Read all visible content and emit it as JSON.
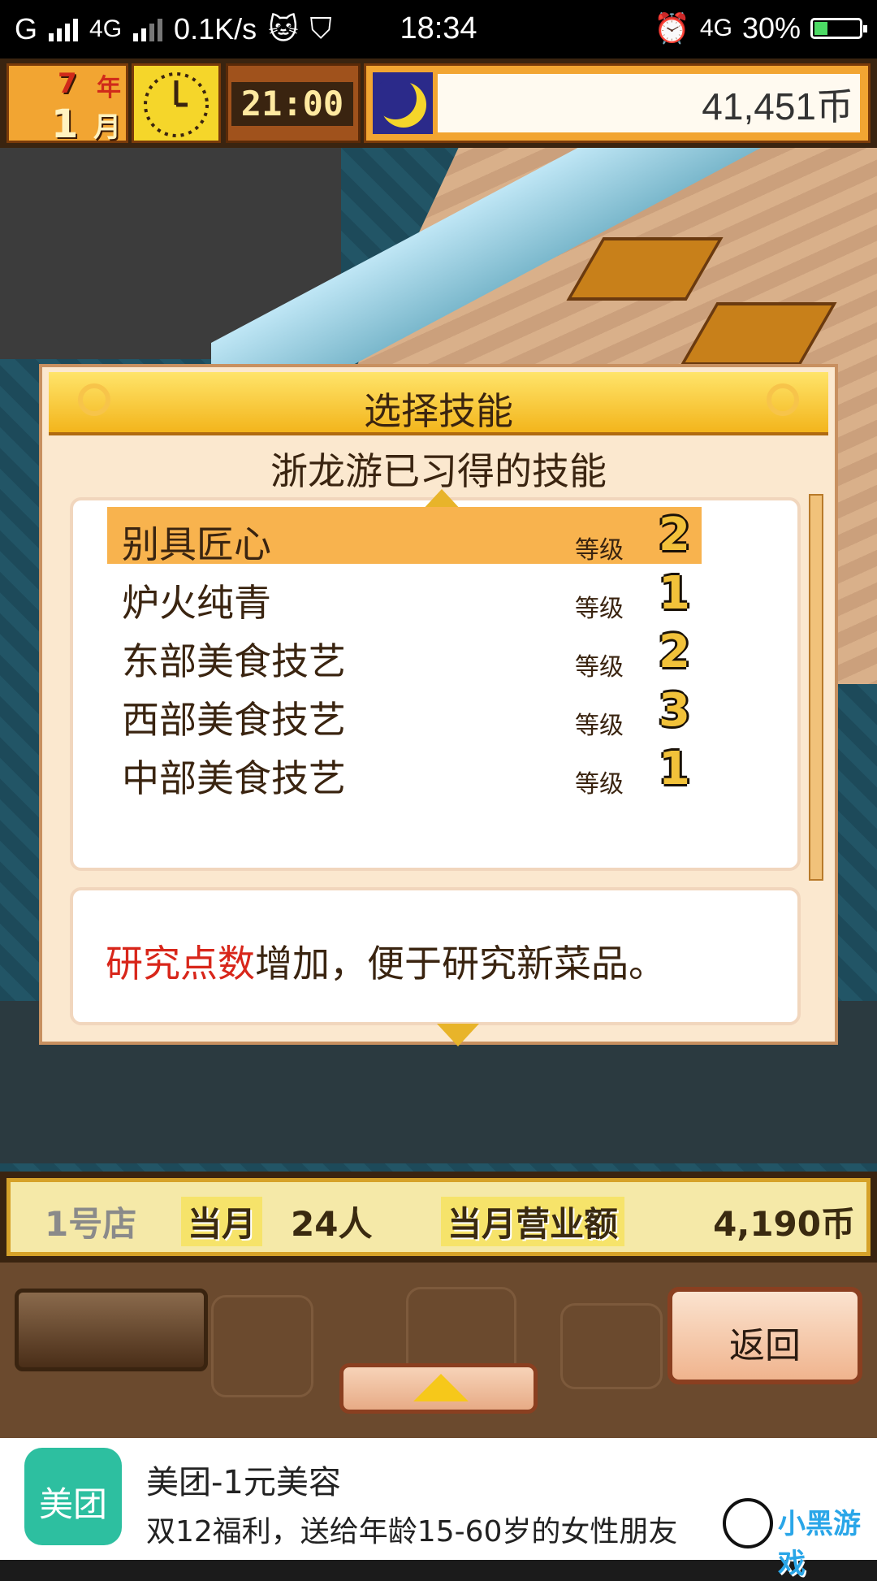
{
  "status_bar": {
    "carrier": "G",
    "network": "4G",
    "speed": "0.1K/s",
    "time": "18:34",
    "network2": "4G",
    "battery": "30%",
    "battery_level": 0.3
  },
  "hud": {
    "year_num": "7",
    "year_label": "年",
    "month_num": "1",
    "month_label": "月",
    "clock_time": "21:00",
    "money": "41,451币"
  },
  "dialog": {
    "title": "选择技能",
    "subtitle": "浙龙游已习得的技能",
    "skills": [
      {
        "name": "别具匠心",
        "level_label": "等级",
        "level": "2"
      },
      {
        "name": "炉火纯青",
        "level_label": "等级",
        "level": "1"
      },
      {
        "name": "东部美食技艺",
        "level_label": "等级",
        "level": "2"
      },
      {
        "name": "西部美食技艺",
        "level_label": "等级",
        "level": "3"
      },
      {
        "name": "中部美食技艺",
        "level_label": "等级",
        "level": "1"
      }
    ],
    "desc_highlight": "研究点数",
    "desc_rest": "增加，便于研究新菜品。"
  },
  "stats": {
    "shop": "1号店",
    "month_label": "当月",
    "customers": "24人",
    "revenue_label": "当月营业额",
    "revenue": "4,190币"
  },
  "panel": {
    "back_label": "返回"
  },
  "ad": {
    "icon_text": "美团",
    "title": "美团-1元美容",
    "desc": "双12福利，送给年龄15-60岁的女性朋友",
    "watermark": "小黑游戏"
  }
}
